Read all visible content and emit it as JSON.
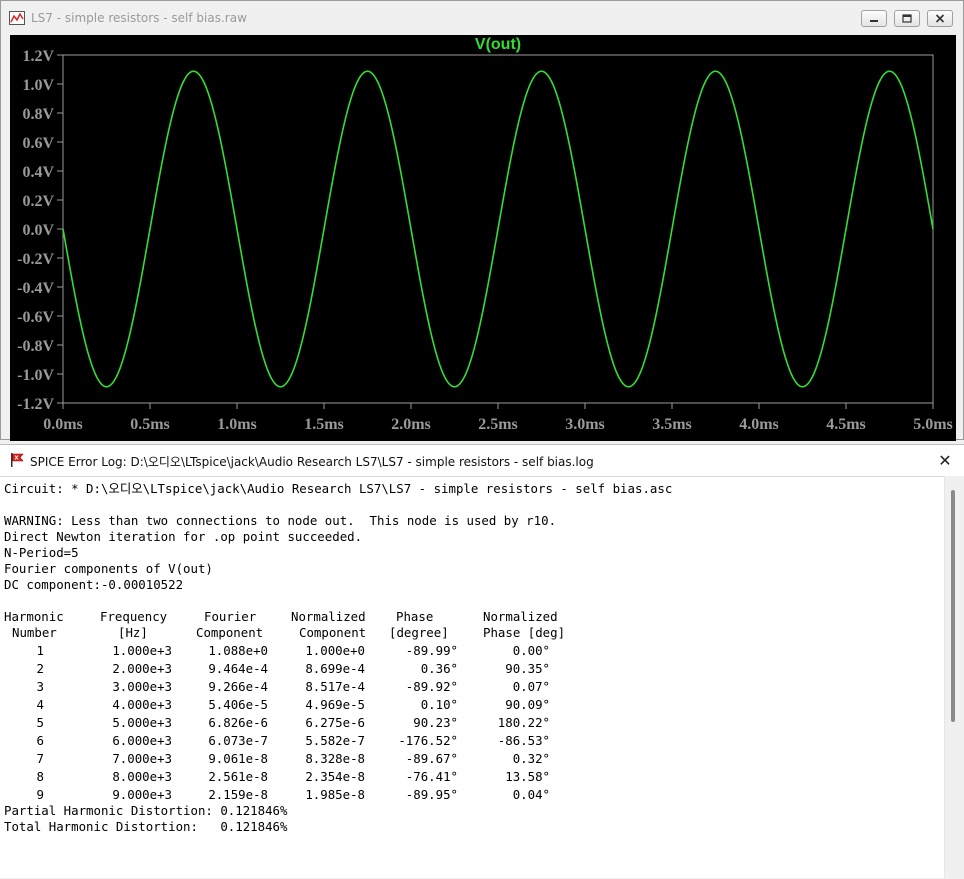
{
  "plot_window": {
    "title": "LS7 - simple resistors - self bias.raw",
    "buttons": {
      "minimize": "minimize-button",
      "restore": "restore-button",
      "close": "close-button"
    }
  },
  "log_window": {
    "title": "SPICE Error Log: D:\\오디오\\LTspice\\jack\\Audio Research LS7\\LS7 - simple resistors - self bias.log",
    "close_glyph": "✕",
    "lines": {
      "circuit": "Circuit: * D:\\오디오\\LTspice\\jack\\Audio Research LS7\\LS7 - simple resistors - self bias.asc",
      "warning": "WARNING: Less than two connections to node out.  This node is used by r10.",
      "newton": "Direct Newton iteration for .op point succeeded.",
      "nperiod": "N-Period=5",
      "fourier": "Fourier components of V(out)",
      "dc": "DC component:-0.00010522",
      "partial_thd": "Partial Harmonic Distortion: 0.121846%",
      "total_thd": "Total Harmonic Distortion:   0.121846%"
    },
    "table": {
      "headers": [
        [
          "Harmonic",
          "Number"
        ],
        [
          "Frequency",
          "[Hz]"
        ],
        [
          "Fourier",
          "Component"
        ],
        [
          "Normalized",
          "Component"
        ],
        [
          "Phase",
          "[degree]"
        ],
        [
          "Normalized",
          "Phase [deg]"
        ]
      ],
      "rows": [
        [
          "1",
          "1.000e+3",
          "1.088e+0",
          "1.000e+0",
          "-89.99°",
          "0.00°"
        ],
        [
          "2",
          "2.000e+3",
          "9.464e-4",
          "8.699e-4",
          "0.36°",
          "90.35°"
        ],
        [
          "3",
          "3.000e+3",
          "9.266e-4",
          "8.517e-4",
          "-89.92°",
          "0.07°"
        ],
        [
          "4",
          "4.000e+3",
          "5.406e-5",
          "4.969e-5",
          "0.10°",
          "90.09°"
        ],
        [
          "5",
          "5.000e+3",
          "6.826e-6",
          "6.275e-6",
          "90.23°",
          "180.22°"
        ],
        [
          "6",
          "6.000e+3",
          "6.073e-7",
          "5.582e-7",
          "-176.52°",
          "-86.53°"
        ],
        [
          "7",
          "7.000e+3",
          "9.061e-8",
          "8.328e-8",
          "-89.67°",
          "0.32°"
        ],
        [
          "8",
          "8.000e+3",
          "2.561e-8",
          "2.354e-8",
          "-76.41°",
          "13.58°"
        ],
        [
          "9",
          "9.000e+3",
          "2.159e-8",
          "1.985e-8",
          "-89.95°",
          "0.04°"
        ]
      ]
    }
  },
  "chart_data": {
    "type": "line",
    "title": "V(out)",
    "xlabel": "",
    "ylabel": "",
    "xlim": [
      0,
      5
    ],
    "ylim": [
      -1.2,
      1.2
    ],
    "x_ticks": [
      "0.0ms",
      "0.5ms",
      "1.0ms",
      "1.5ms",
      "2.0ms",
      "2.5ms",
      "3.0ms",
      "3.5ms",
      "4.0ms",
      "4.5ms",
      "5.0ms"
    ],
    "y_ticks": [
      "1.2V",
      "1.0V",
      "0.8V",
      "0.6V",
      "0.4V",
      "0.2V",
      "0.0V",
      "-0.2V",
      "-0.4V",
      "-0.6V",
      "-0.8V",
      "-1.0V",
      "-1.2V"
    ],
    "grid": false,
    "colors": {
      "trace": "#33dd33",
      "background": "#000000",
      "axis": "#9a9a9a"
    },
    "series": [
      {
        "name": "V(out)",
        "x": [
          0,
          0.125,
          0.25,
          0.375,
          0.5,
          0.625,
          0.75,
          0.875,
          1.0,
          1.125,
          1.25,
          1.375,
          1.5,
          1.625,
          1.75,
          1.875,
          2.0,
          2.125,
          2.25,
          2.375,
          2.5,
          2.625,
          2.75,
          2.875,
          3.0,
          3.125,
          3.25,
          3.375,
          3.5,
          3.625,
          3.75,
          3.875,
          4.0,
          4.125,
          4.25,
          4.375,
          4.5,
          4.625,
          4.75,
          4.875,
          5.0
        ],
        "y": [
          0.0,
          -0.77,
          -1.088,
          -0.77,
          0.0,
          0.77,
          1.088,
          0.77,
          0.0,
          -0.77,
          -1.088,
          -0.77,
          0.0,
          0.77,
          1.088,
          0.77,
          0.0,
          -0.77,
          -1.088,
          -0.77,
          0.0,
          0.77,
          1.088,
          0.77,
          0.0,
          -0.77,
          -1.088,
          -0.77,
          0.0,
          0.77,
          1.088,
          0.77,
          0.0,
          -0.77,
          -1.088,
          -0.77,
          0.0,
          0.77,
          1.088,
          0.77,
          0.0
        ]
      }
    ]
  }
}
